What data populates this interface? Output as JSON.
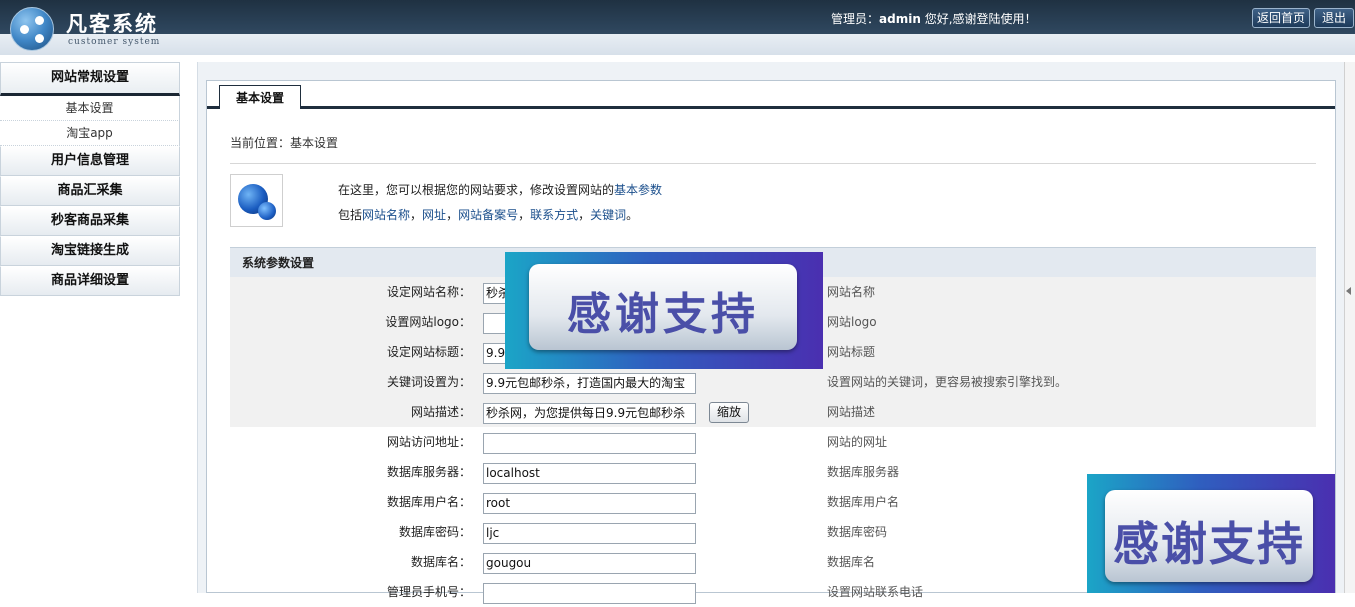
{
  "header": {
    "logo_title": "凡客系统",
    "logo_subtitle": "customer system",
    "admin_prefix": "管理员：",
    "admin_name": "admin",
    "admin_suffix": " 您好,感谢登陆使用！",
    "home_button": "返回首页",
    "logout_button": "退出"
  },
  "sidebar": {
    "active_group": "网站常规设置",
    "sub_items": [
      "基本设置",
      "淘宝app"
    ],
    "groups": [
      "用户信息管理",
      "商品汇采集",
      "秒客商品采集",
      "淘宝链接生成",
      "商品详细设置"
    ]
  },
  "tab": {
    "label": "基本设置"
  },
  "breadcrumb": "当前位置：基本设置",
  "intro": {
    "line1_text": "在这里，您可以根据您的网站要求，修改设置网站的",
    "line1_link": "基本参数",
    "line2_prefix": "包括",
    "line2_links": [
      "网站名称",
      "网址",
      "网站备案号",
      "联系方式",
      "关键词"
    ],
    "line2_seps": [
      "，",
      "，",
      "，",
      "，"
    ],
    "line2_end": "。"
  },
  "section_title": "系统参数设置",
  "form_rows": [
    {
      "label": "设定网站名称：",
      "value": "秒杀",
      "hint": "网站名称"
    },
    {
      "label": "设置网站logo：",
      "value": "",
      "hint": "网站logo"
    },
    {
      "label": "设定网站标题：",
      "value": "9.9",
      "hint": "网站标题"
    },
    {
      "label": "关键词设置为：",
      "value": "9.9元包邮秒杀，打造国内最大的淘宝",
      "hint": "设置网站的关键词，更容易被搜索引擎找到。"
    },
    {
      "label": "网站描述：",
      "value": "秒杀网，为您提供每日9.9元包邮秒杀",
      "hint": "网站描述",
      "button": "缩放"
    },
    {
      "label": "网站访问地址：",
      "value": "",
      "hint": "网站的网址"
    },
    {
      "label": "数据库服务器：",
      "value": "localhost",
      "hint": "数据库服务器"
    },
    {
      "label": "数据库用户名：",
      "value": "root",
      "hint": "数据库用户名"
    },
    {
      "label": "数据库密码：",
      "value": "ljc",
      "hint": "数据库密码"
    },
    {
      "label": "数据库名：",
      "value": "gougou",
      "hint": "数据库名"
    },
    {
      "label": "管理员手机号：",
      "value": "",
      "hint": "设置网站联系电话"
    }
  ],
  "watermark_text": "感谢支持",
  "colors": {
    "header_dark": "#1f3142",
    "accent_link": "#1b4f8c",
    "section_bg": "#e3e9f0",
    "watermark_text": "#4a4fa8"
  },
  "icons": [
    "logo-network-icon",
    "globe-icon",
    "scroll-left-arrow-icon"
  ]
}
